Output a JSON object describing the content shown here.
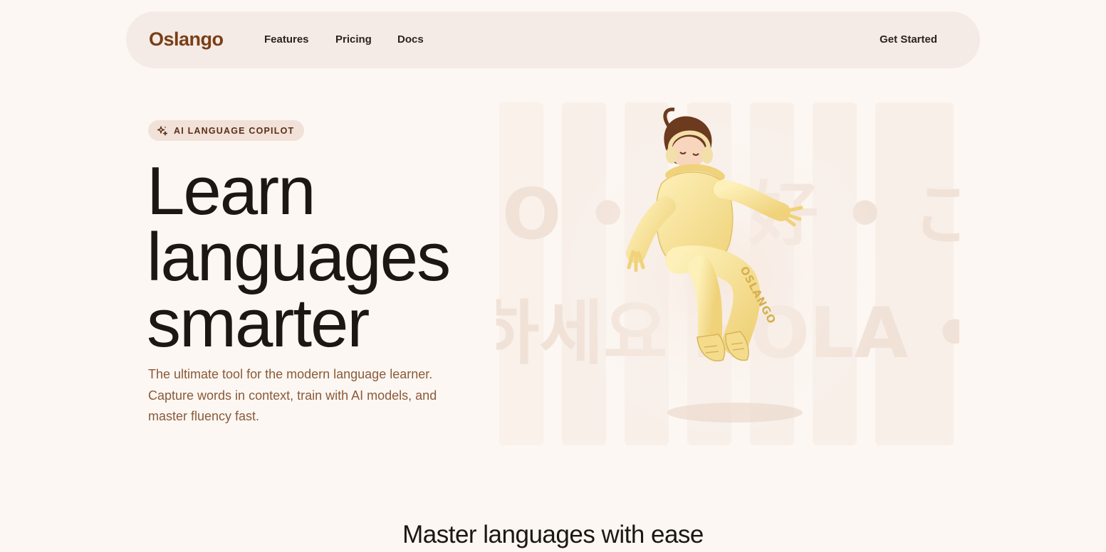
{
  "nav": {
    "logo": "Oslango",
    "links": [
      {
        "label": "Features"
      },
      {
        "label": "Pricing"
      },
      {
        "label": "Docs"
      }
    ],
    "cta_label": "Get Started"
  },
  "hero": {
    "badge": {
      "icon": "sparkles-icon",
      "label": "AI LANGUAGE COPILOT"
    },
    "title_lines": [
      "Learn",
      "languages",
      "smarter"
    ],
    "subtitle": "The ultimate tool for the modern language learner. Capture words in context, train with AI models, and master fluency fast.",
    "background_words": {
      "row1": "O • 你 好 • こ",
      "row2": "하세요 HOLA •"
    },
    "mascot": {
      "shirt_text": "OSLANGO"
    }
  },
  "features": {
    "title": "Master languages with ease"
  },
  "colors": {
    "background": "#fcf7f2",
    "nav_background": "#f5ebe6",
    "brand": "#7a3e16",
    "subtitle": "#8a5a3a",
    "badge_background": "#f1e1d8"
  }
}
